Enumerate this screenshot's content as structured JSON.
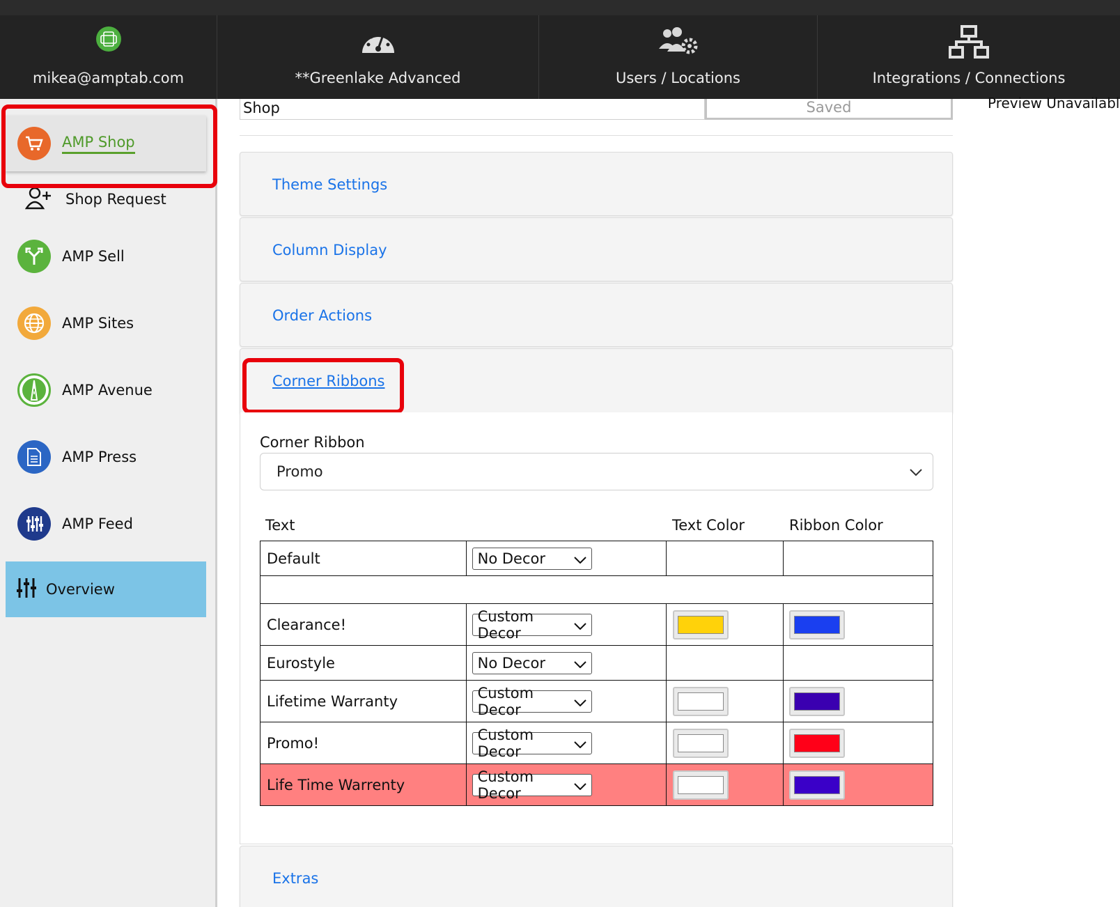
{
  "topnav": {
    "user_email": "mikea@amptab.com",
    "greenlake": "**Greenlake Advanced",
    "users": "Users / Locations",
    "integrations": "Integrations / Connections"
  },
  "sidebar": {
    "amp_shop": "AMP Shop",
    "shop_request": "Shop Request",
    "amp_sell": "AMP Sell",
    "amp_sites": "AMP Sites",
    "amp_avenue": "AMP Avenue",
    "amp_press": "AMP Press",
    "amp_feed": "AMP Feed",
    "overview": "Overview"
  },
  "main": {
    "shop_value": "Shop",
    "saved_label": "Saved",
    "preview": "Preview Unavailable",
    "sections": {
      "theme": "Theme Settings",
      "column": "Column Display",
      "order": "Order Actions",
      "corner": "Corner Ribbons",
      "extras": "Extras"
    },
    "corner_ribbon_label": "Corner Ribbon",
    "corner_ribbon_selected": "Promo",
    "table_headers": {
      "text": "Text",
      "text_color": "Text Color",
      "ribbon_color": "Ribbon Color"
    },
    "rows": [
      {
        "text": "Default",
        "decor": "No Decor"
      },
      {
        "text": "Clearance!",
        "decor": "Custom Decor",
        "text_color": "#ffd20a",
        "ribbon_color": "#1a3ff0"
      },
      {
        "text": "Eurostyle",
        "decor": "No Decor"
      },
      {
        "text": "Lifetime Warranty",
        "decor": "Custom Decor",
        "text_color": "#ffffff",
        "ribbon_color": "#3a00b0"
      },
      {
        "text": "Promo!",
        "decor": "Custom Decor",
        "text_color": "#ffffff",
        "ribbon_color": "#ff0018"
      },
      {
        "text": "Life Time Warrenty",
        "decor": "Custom Decor",
        "text_color": "#ffffff",
        "ribbon_color": "#3a00c8"
      }
    ]
  },
  "colors": {
    "link_blue": "#1a73e8",
    "active_green": "#5aa02c",
    "highlight_row": "#ff8080",
    "annotation_red": "#e8000b",
    "overview_blue": "#7cc4e6"
  }
}
